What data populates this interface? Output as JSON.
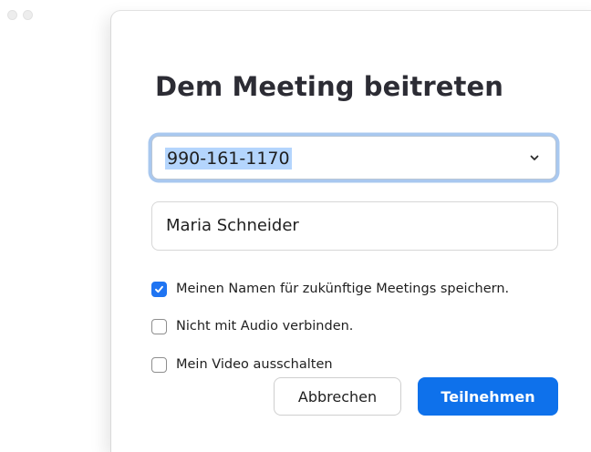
{
  "dialog": {
    "title": "Dem Meeting beitreten",
    "meeting_id": {
      "value": "990-161-1170",
      "icon": "chevron-down-icon"
    },
    "name_field": {
      "value": "Maria Schneider"
    },
    "options": [
      {
        "label": "Meinen Namen für zukünftige Meetings speichern.",
        "checked": true
      },
      {
        "label": "Nicht mit Audio verbinden.",
        "checked": false
      },
      {
        "label": "Mein Video ausschalten",
        "checked": false
      }
    ],
    "buttons": {
      "cancel": "Abbrechen",
      "join": "Teilnehmen"
    }
  },
  "colors": {
    "accent": "#0e71eb",
    "checkbox_checked": "#1f74f2",
    "selection_highlight": "#b4d5fd",
    "focus_ring": "#a9c8ef"
  }
}
